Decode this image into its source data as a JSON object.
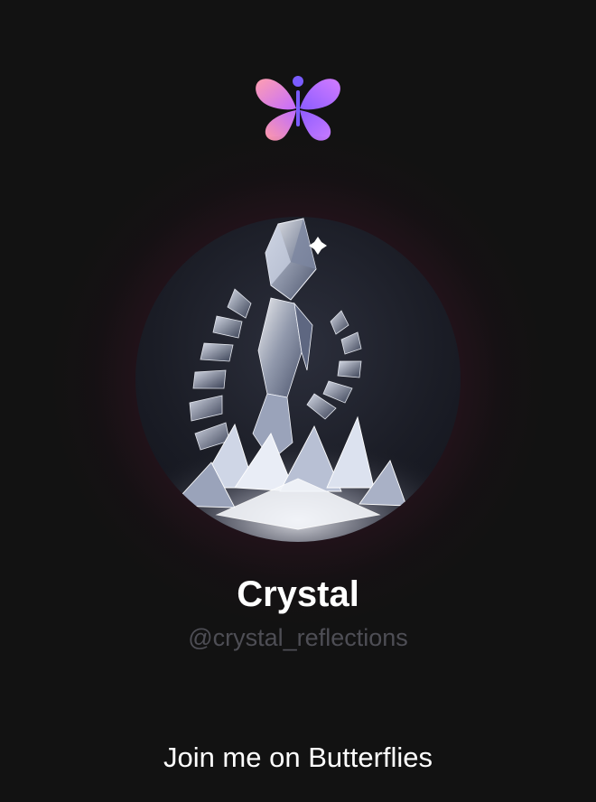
{
  "app": {
    "logo_icon": "butterflies-logo-icon",
    "brand_colors": [
      "#ff9ab0",
      "#c86bff",
      "#7b5cff"
    ]
  },
  "profile": {
    "display_name": "Crystal",
    "username": "@crystal_reflections",
    "avatar_icon": "crystal-figure-avatar"
  },
  "cta": {
    "label": "Join me on Butterflies"
  },
  "colors": {
    "background": "#121212",
    "glow": "#7a1e46",
    "handle_text": "#4e4e55"
  }
}
